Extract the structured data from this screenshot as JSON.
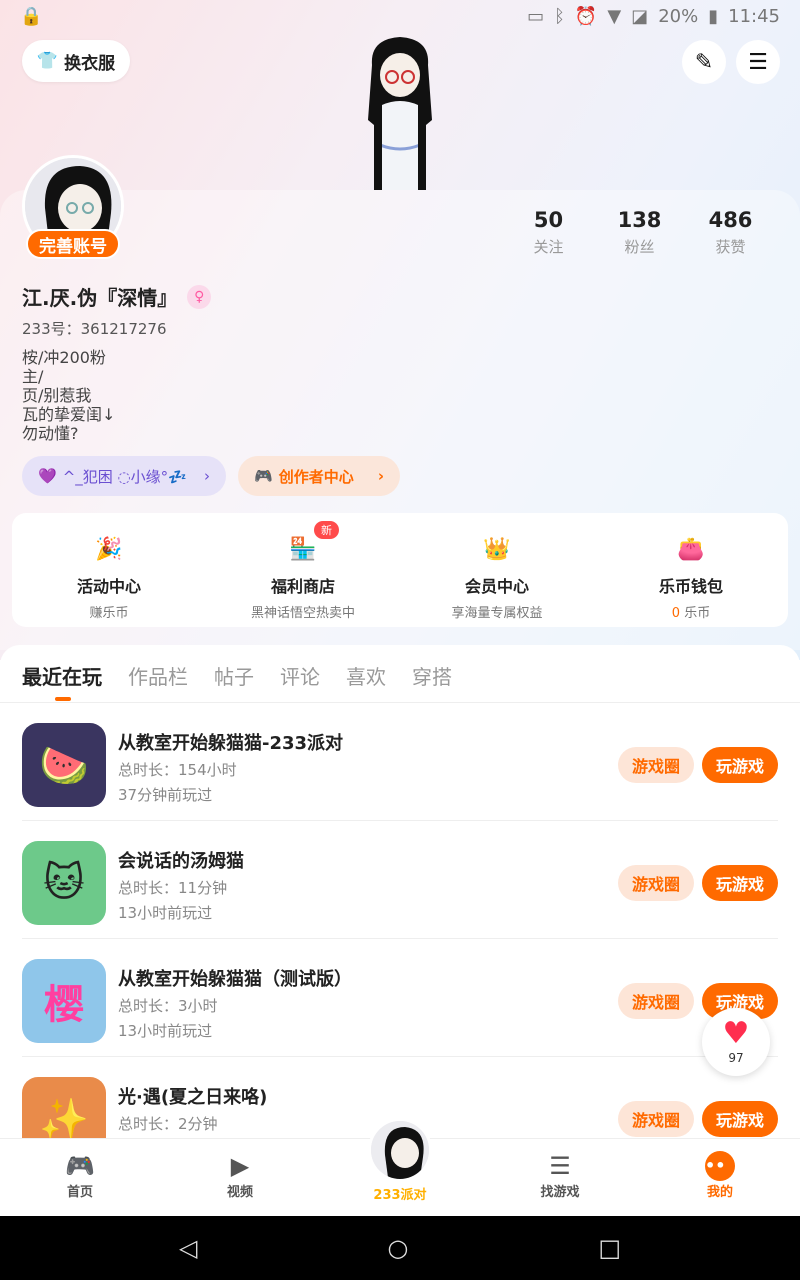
{
  "status_bar": {
    "battery": "20%",
    "time": "11:45"
  },
  "header": {
    "dress_label": "换衣服"
  },
  "profile": {
    "complete_label": "完善账号",
    "name": "江.厌.伪『深情』",
    "gender_symbol": "♀",
    "uid": "233号：361217276",
    "bio": [
      "桉/冲200粉",
      "主/",
      "页/别惹我",
      "瓦的挚爱闺↓",
      "勿动懂?"
    ],
    "stats": [
      {
        "num": "50",
        "label": "关注"
      },
      {
        "num": "138",
        "label": "粉丝"
      },
      {
        "num": "486",
        "label": "获赞"
      }
    ],
    "cp_chip": "^_犯困 ◌小缘°💤",
    "creator_chip": "创作者中心"
  },
  "features": [
    {
      "title": "活动中心",
      "sub": "赚乐币",
      "icon": "party-popper-icon",
      "glyph": "🎉"
    },
    {
      "title": "福利商店",
      "sub": "黑神话悟空热卖中",
      "icon": "shop-icon",
      "glyph": "🏪",
      "badge": "新"
    },
    {
      "title": "会员中心",
      "sub": "享海量专属权益",
      "icon": "crown-icon",
      "glyph": "👑"
    },
    {
      "title": "乐币钱包",
      "sub_zero": "0",
      "sub": " 乐币",
      "icon": "wallet-icon",
      "glyph": "👛"
    }
  ],
  "tabs": [
    "最近在玩",
    "作品栏",
    "帖子",
    "评论",
    "喜欢",
    "穿搭"
  ],
  "games": [
    {
      "name": "从教室开始躲猫猫-233派对",
      "duration": "总时长：154小时",
      "last": "37分钟前玩过",
      "circle": "游戏圈",
      "play": "玩游戏",
      "glyph": "🍉",
      "bg": "#3a3560"
    },
    {
      "name": "会说话的汤姆猫",
      "duration": "总时长：11分钟",
      "last": "13小时前玩过",
      "circle": "游戏圈",
      "play": "玩游戏",
      "glyph": "🐱",
      "bg": "#6dc98a"
    },
    {
      "name": "从教室开始躲猫猫（测试版）",
      "duration": "总时长：3小时",
      "last": "13小时前玩过",
      "circle": "游戏圈",
      "play": "玩游戏",
      "glyph": "樱",
      "bg": "#8fc6ea"
    },
    {
      "name": "光·遇(夏之日来咯)",
      "duration": "总时长：2分钟",
      "last": "",
      "circle": "游戏圈",
      "play": "玩游戏",
      "glyph": "✨",
      "bg": "#e98b4a"
    }
  ],
  "like_count": "97",
  "bottom_nav": [
    {
      "label": "首页",
      "icon": "gamepad-icon",
      "glyph": "🎮"
    },
    {
      "label": "视频",
      "icon": "video-icon",
      "glyph": "▶"
    },
    {
      "label": "233派对",
      "icon": "party-avatar",
      "glyph": ""
    },
    {
      "label": "找游戏",
      "icon": "list-icon",
      "glyph": "☰"
    },
    {
      "label": "我的",
      "icon": "me-icon",
      "glyph": "••"
    }
  ],
  "colors": {
    "accent": "#ff6a00",
    "cp": "#6a4fd1"
  }
}
